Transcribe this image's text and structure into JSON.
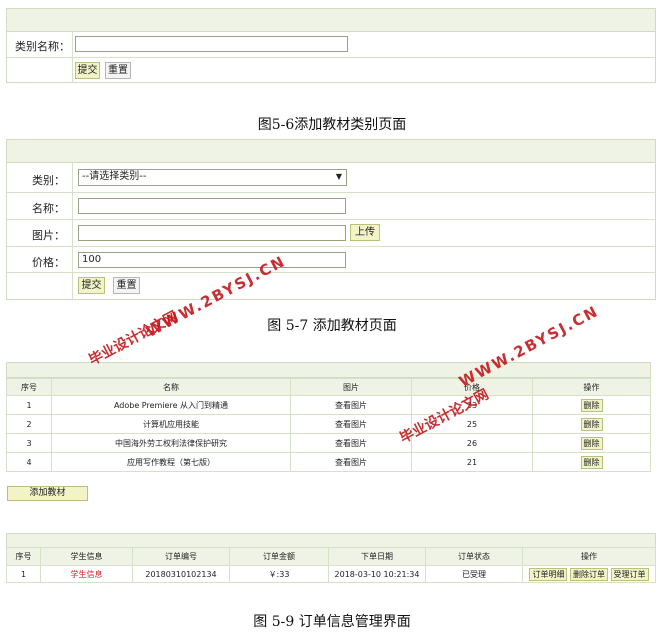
{
  "fig56": {
    "label": "类别名称：",
    "input_value": "",
    "submit": "提交",
    "reset": "重置",
    "caption": "图5-6添加教材类别页面"
  },
  "fig57": {
    "category_label": "类别：",
    "category_value": "--请选择类别--",
    "name_label": "名称：",
    "name_value": "",
    "image_label": "图片：",
    "image_value": "",
    "upload": "上传",
    "price_label": "价格：",
    "price_value": "100",
    "submit": "提交",
    "reset": "重置",
    "caption": "图 5-7  添加教材页面"
  },
  "books": {
    "headers": [
      "序号",
      "名称",
      "图片",
      "价格",
      "操作"
    ],
    "rows": [
      {
        "no": "1",
        "name": "Adobe Premiere 从入门到精通",
        "img": "查看图片",
        "price": "33",
        "op": "删除"
      },
      {
        "no": "2",
        "name": "计算机应用技能",
        "img": "查看图片",
        "price": "25",
        "op": "删除"
      },
      {
        "no": "3",
        "name": "中国海外劳工权利法律保护研究",
        "img": "查看图片",
        "price": "26",
        "op": "删除"
      },
      {
        "no": "4",
        "name": "应用写作教程（第七版）",
        "img": "查看图片",
        "price": "21",
        "op": "删除"
      }
    ],
    "add_button": "添加教材"
  },
  "orders": {
    "headers": [
      "序号",
      "学生信息",
      "订单编号",
      "订单金额",
      "下单日期",
      "订单状态",
      "操作"
    ],
    "row": {
      "no": "1",
      "student": "学生信息",
      "order_no": "20180310102134",
      "amount": "￥:33",
      "date": "2018-03-10 10:21:34",
      "status": "已受理",
      "ops": [
        "订单明细",
        "删除订单",
        "受理订单"
      ]
    },
    "caption": "图 5-9 订单信息管理界面"
  },
  "watermarks": {
    "site_a": "WWW.2BYSJ.CN",
    "name_a": "毕业设计论文网",
    "site_b": "WWW.2BYSJ.CN",
    "name_b": "毕业设计论文网"
  },
  "colors": {
    "header_bg": "#eef3e6",
    "border": "#cfdcc0",
    "button_bg": "#f2f3c7",
    "watermark": "#c4181c"
  }
}
